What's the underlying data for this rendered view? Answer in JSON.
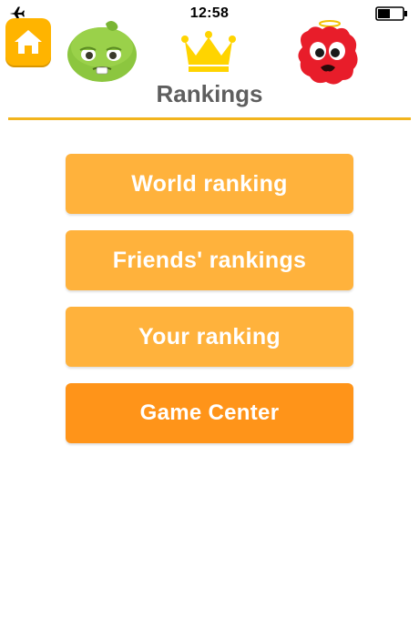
{
  "status_bar": {
    "time": "12:58",
    "airplane_icon": "airplane-icon",
    "battery_icon": "battery-icon"
  },
  "header": {
    "title": "Rankings",
    "home_icon": "home-icon",
    "crown_icon": "crown-icon",
    "mascots": [
      "green-monster-mascot",
      "red-monster-mascot"
    ]
  },
  "menu": {
    "world_ranking": "World ranking",
    "friends_rankings": "Friends' rankings",
    "your_ranking": "Your ranking",
    "game_center": "Game Center"
  },
  "colors": {
    "accent_yellow": "#f2b41d",
    "button_light": "#ffb23c",
    "button_dark": "#ff9419",
    "home_button": "#ffb400",
    "title_gray": "#5e5e5e"
  }
}
